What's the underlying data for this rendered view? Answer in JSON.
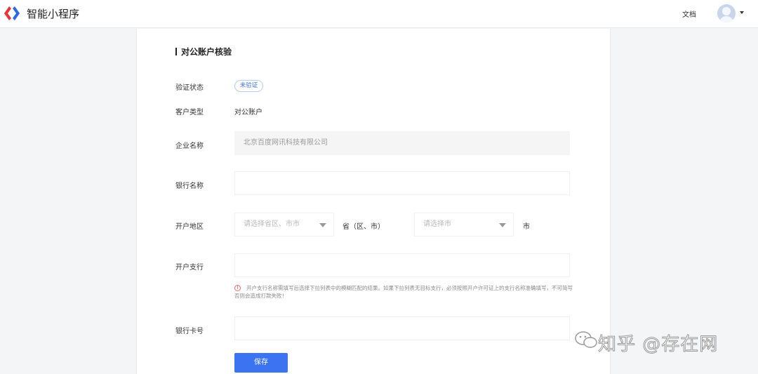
{
  "header": {
    "app_name": "智能小程序",
    "docs_link": "文档"
  },
  "form": {
    "title": "对公账户核验",
    "verify_status": {
      "label": "验证状态",
      "value": "未验证"
    },
    "customer_type": {
      "label": "客户类型",
      "value": "对公账户"
    },
    "company_name": {
      "label": "企业名称",
      "value": "北京百度网讯科技有限公司"
    },
    "bank_name": {
      "label": "银行名称",
      "value": ""
    },
    "region": {
      "label": "开户地区",
      "province_placeholder": "请选择省区、市市",
      "province_suffix": "省（区、市）",
      "city_placeholder": "请选择市",
      "city_suffix": "市"
    },
    "branch": {
      "label": "开户支行",
      "value": "",
      "hint": "开户支行名称需填写后选择下拉列表中的模糊匹配的结果。如果下拉列表无目标支行，必须按照开户许可证上的支行名称准确填写，不可简写否则会造成打款失败！"
    },
    "card_no": {
      "label": "银行卡号",
      "value": ""
    },
    "save_label": "保存"
  },
  "watermark": "知乎 @存在网",
  "colors": {
    "primary": "#3b73f0",
    "badge": "#3a6fe0",
    "warning": "#e66a6a"
  }
}
